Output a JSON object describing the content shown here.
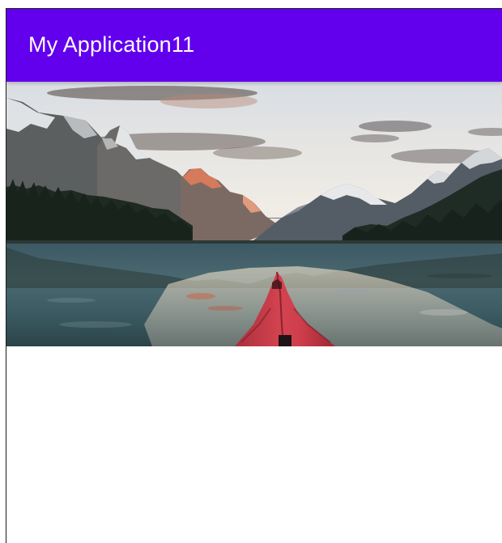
{
  "app_bar": {
    "title": "My Application11",
    "color": "#6200EE"
  },
  "hero_image": {
    "description": "mountain-lake-kayak-photo"
  }
}
